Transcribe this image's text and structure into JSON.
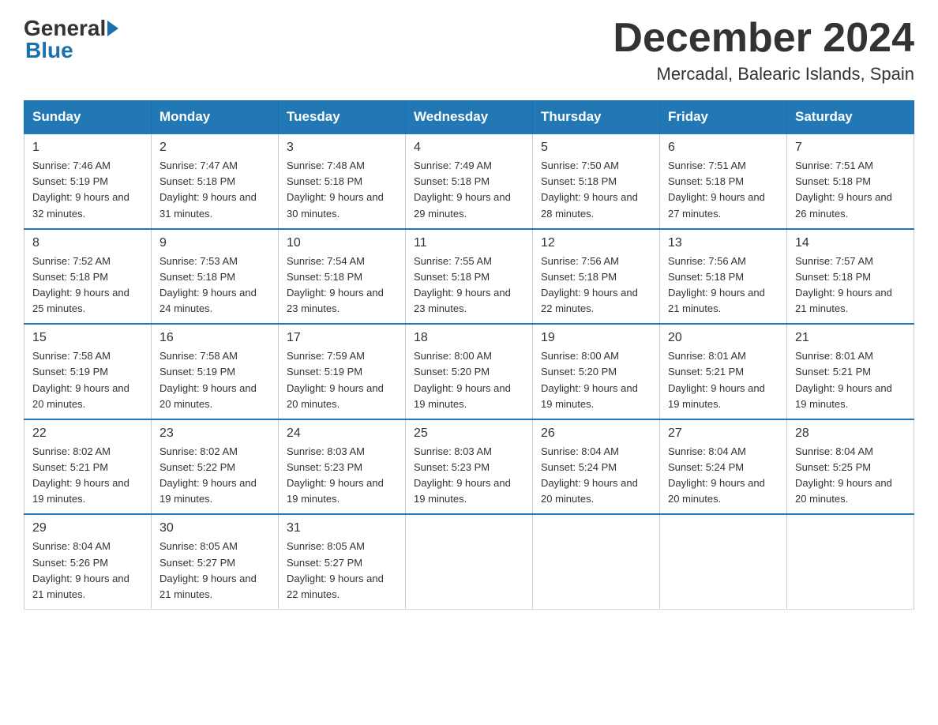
{
  "header": {
    "logo_general": "General",
    "logo_blue": "Blue",
    "month_title": "December 2024",
    "location": "Mercadal, Balearic Islands, Spain"
  },
  "columns": [
    "Sunday",
    "Monday",
    "Tuesday",
    "Wednesday",
    "Thursday",
    "Friday",
    "Saturday"
  ],
  "weeks": [
    [
      {
        "day": "1",
        "sunrise": "7:46 AM",
        "sunset": "5:19 PM",
        "daylight": "9 hours and 32 minutes."
      },
      {
        "day": "2",
        "sunrise": "7:47 AM",
        "sunset": "5:18 PM",
        "daylight": "9 hours and 31 minutes."
      },
      {
        "day": "3",
        "sunrise": "7:48 AM",
        "sunset": "5:18 PM",
        "daylight": "9 hours and 30 minutes."
      },
      {
        "day": "4",
        "sunrise": "7:49 AM",
        "sunset": "5:18 PM",
        "daylight": "9 hours and 29 minutes."
      },
      {
        "day": "5",
        "sunrise": "7:50 AM",
        "sunset": "5:18 PM",
        "daylight": "9 hours and 28 minutes."
      },
      {
        "day": "6",
        "sunrise": "7:51 AM",
        "sunset": "5:18 PM",
        "daylight": "9 hours and 27 minutes."
      },
      {
        "day": "7",
        "sunrise": "7:51 AM",
        "sunset": "5:18 PM",
        "daylight": "9 hours and 26 minutes."
      }
    ],
    [
      {
        "day": "8",
        "sunrise": "7:52 AM",
        "sunset": "5:18 PM",
        "daylight": "9 hours and 25 minutes."
      },
      {
        "day": "9",
        "sunrise": "7:53 AM",
        "sunset": "5:18 PM",
        "daylight": "9 hours and 24 minutes."
      },
      {
        "day": "10",
        "sunrise": "7:54 AM",
        "sunset": "5:18 PM",
        "daylight": "9 hours and 23 minutes."
      },
      {
        "day": "11",
        "sunrise": "7:55 AM",
        "sunset": "5:18 PM",
        "daylight": "9 hours and 23 minutes."
      },
      {
        "day": "12",
        "sunrise": "7:56 AM",
        "sunset": "5:18 PM",
        "daylight": "9 hours and 22 minutes."
      },
      {
        "day": "13",
        "sunrise": "7:56 AM",
        "sunset": "5:18 PM",
        "daylight": "9 hours and 21 minutes."
      },
      {
        "day": "14",
        "sunrise": "7:57 AM",
        "sunset": "5:18 PM",
        "daylight": "9 hours and 21 minutes."
      }
    ],
    [
      {
        "day": "15",
        "sunrise": "7:58 AM",
        "sunset": "5:19 PM",
        "daylight": "9 hours and 20 minutes."
      },
      {
        "day": "16",
        "sunrise": "7:58 AM",
        "sunset": "5:19 PM",
        "daylight": "9 hours and 20 minutes."
      },
      {
        "day": "17",
        "sunrise": "7:59 AM",
        "sunset": "5:19 PM",
        "daylight": "9 hours and 20 minutes."
      },
      {
        "day": "18",
        "sunrise": "8:00 AM",
        "sunset": "5:20 PM",
        "daylight": "9 hours and 19 minutes."
      },
      {
        "day": "19",
        "sunrise": "8:00 AM",
        "sunset": "5:20 PM",
        "daylight": "9 hours and 19 minutes."
      },
      {
        "day": "20",
        "sunrise": "8:01 AM",
        "sunset": "5:21 PM",
        "daylight": "9 hours and 19 minutes."
      },
      {
        "day": "21",
        "sunrise": "8:01 AM",
        "sunset": "5:21 PM",
        "daylight": "9 hours and 19 minutes."
      }
    ],
    [
      {
        "day": "22",
        "sunrise": "8:02 AM",
        "sunset": "5:21 PM",
        "daylight": "9 hours and 19 minutes."
      },
      {
        "day": "23",
        "sunrise": "8:02 AM",
        "sunset": "5:22 PM",
        "daylight": "9 hours and 19 minutes."
      },
      {
        "day": "24",
        "sunrise": "8:03 AM",
        "sunset": "5:23 PM",
        "daylight": "9 hours and 19 minutes."
      },
      {
        "day": "25",
        "sunrise": "8:03 AM",
        "sunset": "5:23 PM",
        "daylight": "9 hours and 19 minutes."
      },
      {
        "day": "26",
        "sunrise": "8:04 AM",
        "sunset": "5:24 PM",
        "daylight": "9 hours and 20 minutes."
      },
      {
        "day": "27",
        "sunrise": "8:04 AM",
        "sunset": "5:24 PM",
        "daylight": "9 hours and 20 minutes."
      },
      {
        "day": "28",
        "sunrise": "8:04 AM",
        "sunset": "5:25 PM",
        "daylight": "9 hours and 20 minutes."
      }
    ],
    [
      {
        "day": "29",
        "sunrise": "8:04 AM",
        "sunset": "5:26 PM",
        "daylight": "9 hours and 21 minutes."
      },
      {
        "day": "30",
        "sunrise": "8:05 AM",
        "sunset": "5:27 PM",
        "daylight": "9 hours and 21 minutes."
      },
      {
        "day": "31",
        "sunrise": "8:05 AM",
        "sunset": "5:27 PM",
        "daylight": "9 hours and 22 minutes."
      },
      null,
      null,
      null,
      null
    ]
  ]
}
